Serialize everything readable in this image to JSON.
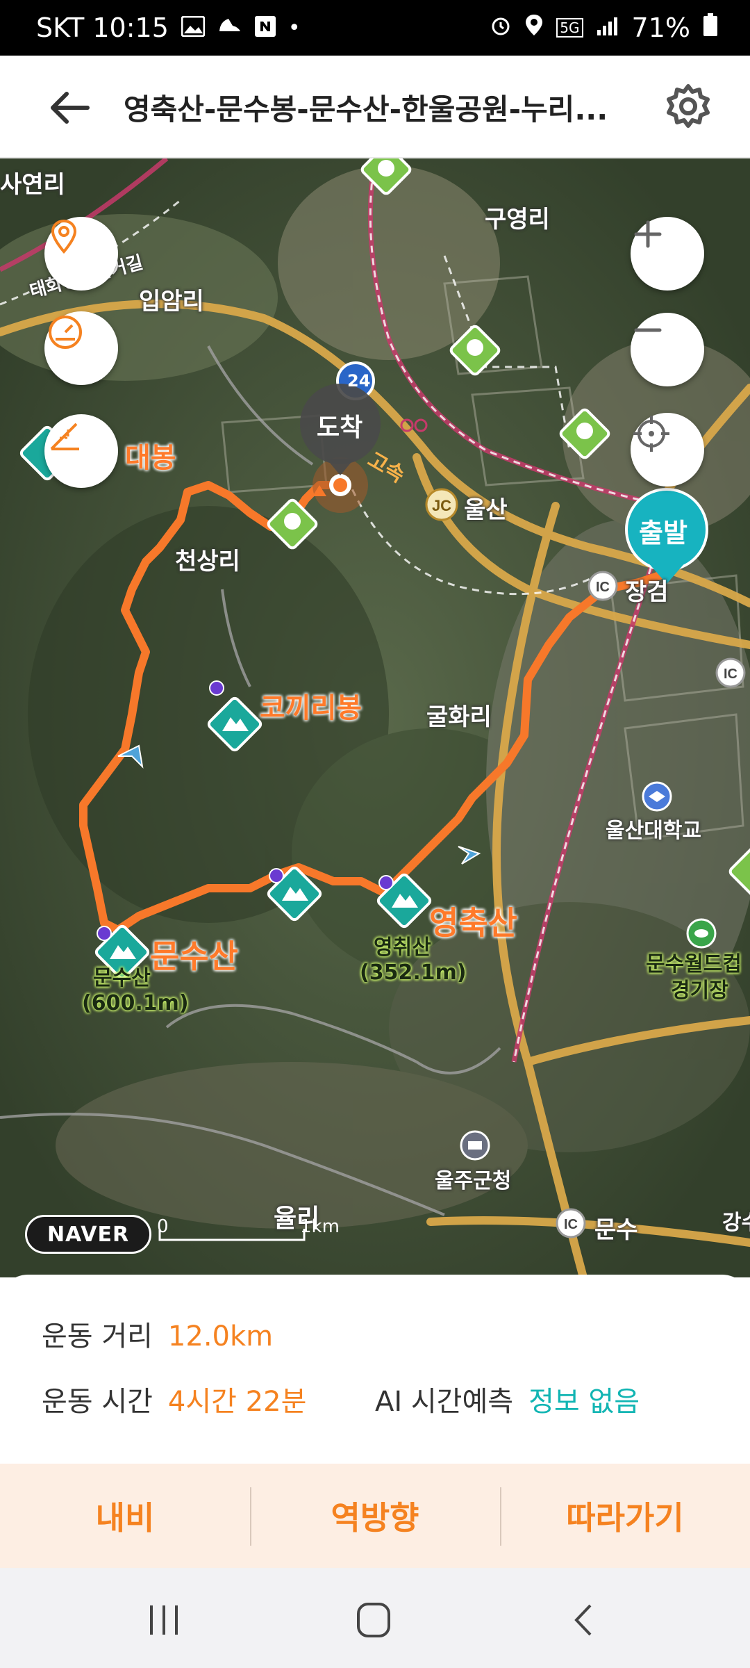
{
  "status_bar": {
    "carrier_time": "SKT 10:15",
    "network": "5G",
    "battery": "71%"
  },
  "header": {
    "title": "영축산-문수봉-문수산-한울공원-누리..."
  },
  "map": {
    "markers": {
      "arrival": "도착",
      "departure": "출발"
    },
    "peaks": {
      "munsu_big": "문수산",
      "munsu_small": "문수산",
      "munsu_elev": "(600.1m)",
      "yeongchuk_big": "영축산",
      "yeongchuk_small": "영취산",
      "yeongchuk_elev": "(352.1m)",
      "kokkiri": "코끼리봉",
      "daebong": "대봉"
    },
    "places": {
      "guyeong": "구영리",
      "ipam": "입암리",
      "cheonsang": "천상리",
      "gulhwa": "굴화리",
      "ulsan_jc": "울산",
      "ulsan_univ": "울산대학교",
      "ulju_office": "울주군청",
      "munsu_ic": "문수",
      "jang": "장검",
      "saeon": "사연리",
      "munsu_world": "문수월드컵",
      "munsu_world2": "경기장",
      "yul": "율리",
      "ganggu": "강수",
      "taehwa": "태화강자전거길",
      "highway": "24",
      "road_label": "고속"
    },
    "attribution": "NAVER",
    "scale": {
      "zero": "0",
      "distance": "1km"
    },
    "colors": {
      "route": "#f7782a",
      "peak_marker": "#1aa89b",
      "departure": "#17b3c0"
    }
  },
  "stats": {
    "distance_label": "운동 거리",
    "distance_value": "12.0km",
    "time_label": "운동 시간",
    "time_value": "4시간 22분",
    "ai_label": "AI 시간예측",
    "ai_value": "정보 없음"
  },
  "actions": {
    "navi": "내비",
    "reverse": "역방향",
    "follow": "따라가기"
  }
}
